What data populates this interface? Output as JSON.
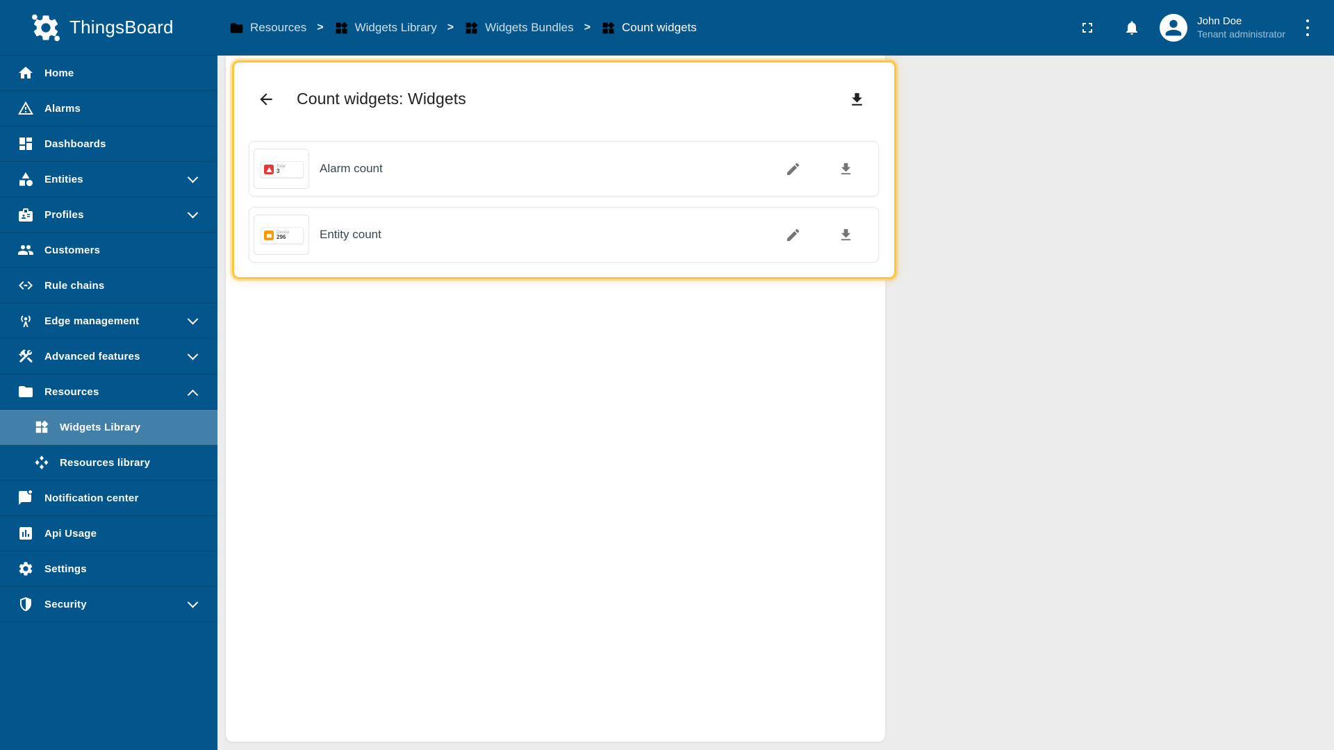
{
  "colors": {
    "primary_blue": "#03568c",
    "highlight_yellow": "#fec53d",
    "alarm_red": "#e53935",
    "entity_orange": "#ff9800",
    "content_bg": "#ececec"
  },
  "sidebar": {
    "logo_text": "ThingsBoard",
    "items": [
      {
        "label": "Home",
        "icon": "home",
        "sub": false,
        "selected": false,
        "chevron": ""
      },
      {
        "label": "Alarms",
        "icon": "alarms",
        "sub": false,
        "selected": false,
        "chevron": ""
      },
      {
        "label": "Dashboards",
        "icon": "dashboards",
        "sub": false,
        "selected": false,
        "chevron": ""
      },
      {
        "label": "Entities",
        "icon": "entities",
        "sub": false,
        "selected": false,
        "chevron": "down"
      },
      {
        "label": "Profiles",
        "icon": "profiles",
        "sub": false,
        "selected": false,
        "chevron": "down"
      },
      {
        "label": "Customers",
        "icon": "customers",
        "sub": false,
        "selected": false,
        "chevron": ""
      },
      {
        "label": "Rule chains",
        "icon": "rulechains",
        "sub": false,
        "selected": false,
        "chevron": ""
      },
      {
        "label": "Edge management",
        "icon": "edge",
        "sub": false,
        "selected": false,
        "chevron": "down"
      },
      {
        "label": "Advanced features",
        "icon": "tools",
        "sub": false,
        "selected": false,
        "chevron": "down"
      },
      {
        "label": "Resources",
        "icon": "folder",
        "sub": false,
        "selected": false,
        "chevron": "up"
      },
      {
        "label": "Widgets Library",
        "icon": "widgets",
        "sub": true,
        "selected": true,
        "chevron": ""
      },
      {
        "label": "Resources library",
        "icon": "diamonds",
        "sub": true,
        "selected": false,
        "chevron": ""
      },
      {
        "label": "Notification center",
        "icon": "message",
        "sub": false,
        "selected": false,
        "chevron": ""
      },
      {
        "label": "Api Usage",
        "icon": "chart",
        "sub": false,
        "selected": false,
        "chevron": ""
      },
      {
        "label": "Settings",
        "icon": "gear",
        "sub": false,
        "selected": false,
        "chevron": ""
      },
      {
        "label": "Security",
        "icon": "shield",
        "sub": false,
        "selected": false,
        "chevron": "down"
      }
    ]
  },
  "topbar": {
    "breadcrumbs": [
      {
        "label": "Resources",
        "icon": "folder"
      },
      {
        "label": "Widgets Library",
        "icon": "widgets"
      },
      {
        "label": "Widgets Bundles",
        "icon": "widgets"
      },
      {
        "label": "Count widgets",
        "icon": "widgets"
      }
    ],
    "separator": ">",
    "user": {
      "name": "John Doe",
      "role": "Tenant administrator"
    }
  },
  "panel": {
    "title": "Count widgets: Widgets",
    "widgets": [
      {
        "name": "Alarm count",
        "thumb": {
          "color": "#e53935",
          "glyph": "warning",
          "label": "Total",
          "value": "3"
        }
      },
      {
        "name": "Entity count",
        "thumb": {
          "color": "#ff9800",
          "glyph": "device",
          "label": "Device",
          "value": "296"
        }
      }
    ]
  }
}
